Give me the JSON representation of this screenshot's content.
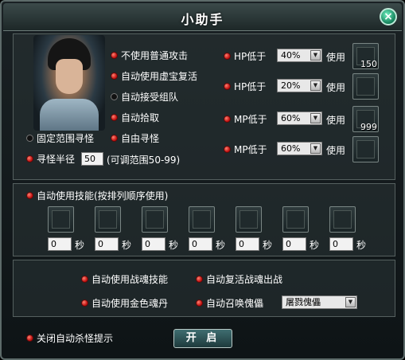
{
  "window": {
    "title": "小助手",
    "close_label": "×"
  },
  "options": {
    "no_normal_attack": "不使用普通攻击",
    "auto_revive_treasure": "自动使用虚宝复活",
    "auto_accept_team": "自动接受组队",
    "auto_pickup": "自动拾取",
    "fixed_range_search": "固定范围寻怪",
    "free_search": "自由寻怪",
    "search_radius_label": "寻怪半径",
    "search_radius_value": "50",
    "search_radius_hint": "(可调范围50-99)"
  },
  "potions": [
    {
      "label": "HP低于",
      "percent": "40%",
      "use_label": "使用",
      "item": "hp-potion",
      "count": "150"
    },
    {
      "label": "HP低于",
      "percent": "20%",
      "use_label": "使用",
      "item": "",
      "count": ""
    },
    {
      "label": "MP低于",
      "percent": "60%",
      "use_label": "使用",
      "item": "mp-potion",
      "count": "999"
    },
    {
      "label": "MP低于",
      "percent": "60%",
      "use_label": "使用",
      "item": "",
      "count": ""
    }
  ],
  "skills": {
    "header": "自动使用技能(按排列顺序使用)",
    "seconds_unit": "秒",
    "slots": [
      {
        "icon": "fire-skill",
        "seconds": "0"
      },
      {
        "icon": "shield-skill",
        "seconds": "0"
      },
      {
        "icon": "",
        "seconds": "0"
      },
      {
        "icon": "",
        "seconds": "0"
      },
      {
        "icon": "",
        "seconds": "0"
      },
      {
        "icon": "",
        "seconds": "0"
      },
      {
        "icon": "",
        "seconds": "0"
      }
    ]
  },
  "spirit": {
    "use_soul_skill": "自动使用战魂技能",
    "revive_soul": "自动复活战魂出战",
    "use_gold_pill": "自动使用金色魂丹",
    "summon_puppet": "自动召唤傀儡",
    "puppet_option": "屠戮傀儡"
  },
  "footer": {
    "close_kill_tip": "关闭自动杀怪提示",
    "start_button": "开 启"
  },
  "colors": {
    "accent_red": "#d01818",
    "text": "#ffffff",
    "frame": "#5d6b6a"
  }
}
